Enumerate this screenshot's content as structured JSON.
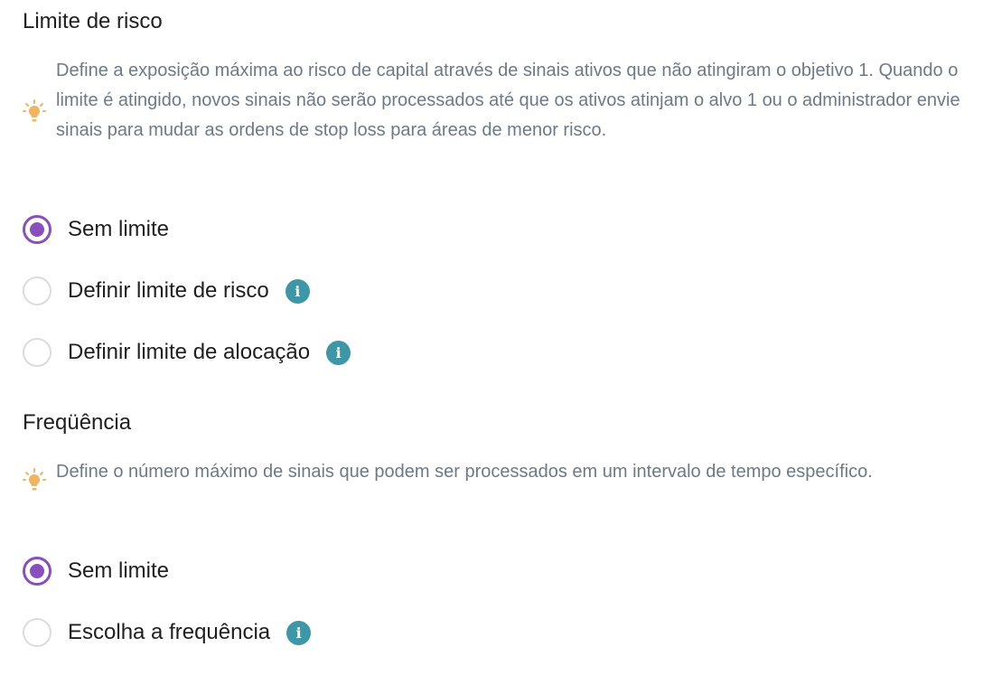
{
  "risk_section": {
    "title": "Limite de risco",
    "hint": "Define a exposição máxima ao risco de capital através de sinais ativos que não atingiram o objetivo 1. Quando o limite é atingido, novos sinais não serão processados até que os ativos atinjam o alvo 1 ou o administrador envie sinais para mudar as ordens de stop loss para áreas de menor risco.",
    "hint_icon": "lightbulb-icon",
    "options": [
      {
        "label": "Sem limite",
        "selected": true,
        "has_info": false
      },
      {
        "label": "Definir limite de risco",
        "selected": false,
        "has_info": true
      },
      {
        "label": "Definir limite de alocação",
        "selected": false,
        "has_info": true
      }
    ]
  },
  "frequency_section": {
    "title": "Freqüência",
    "hint": "Define o número máximo de sinais que podem ser processados em um intervalo de tempo específico.",
    "hint_icon": "lightbulb-icon",
    "options": [
      {
        "label": "Sem limite",
        "selected": true,
        "has_info": false
      },
      {
        "label": "Escolha a frequência",
        "selected": false,
        "has_info": true
      }
    ]
  },
  "info_icon_glyph": "i",
  "colors": {
    "accent": "#8a4fbf",
    "info": "#3d97a6",
    "bulb": "#f2b45c",
    "hint_text": "#6d7a86"
  }
}
